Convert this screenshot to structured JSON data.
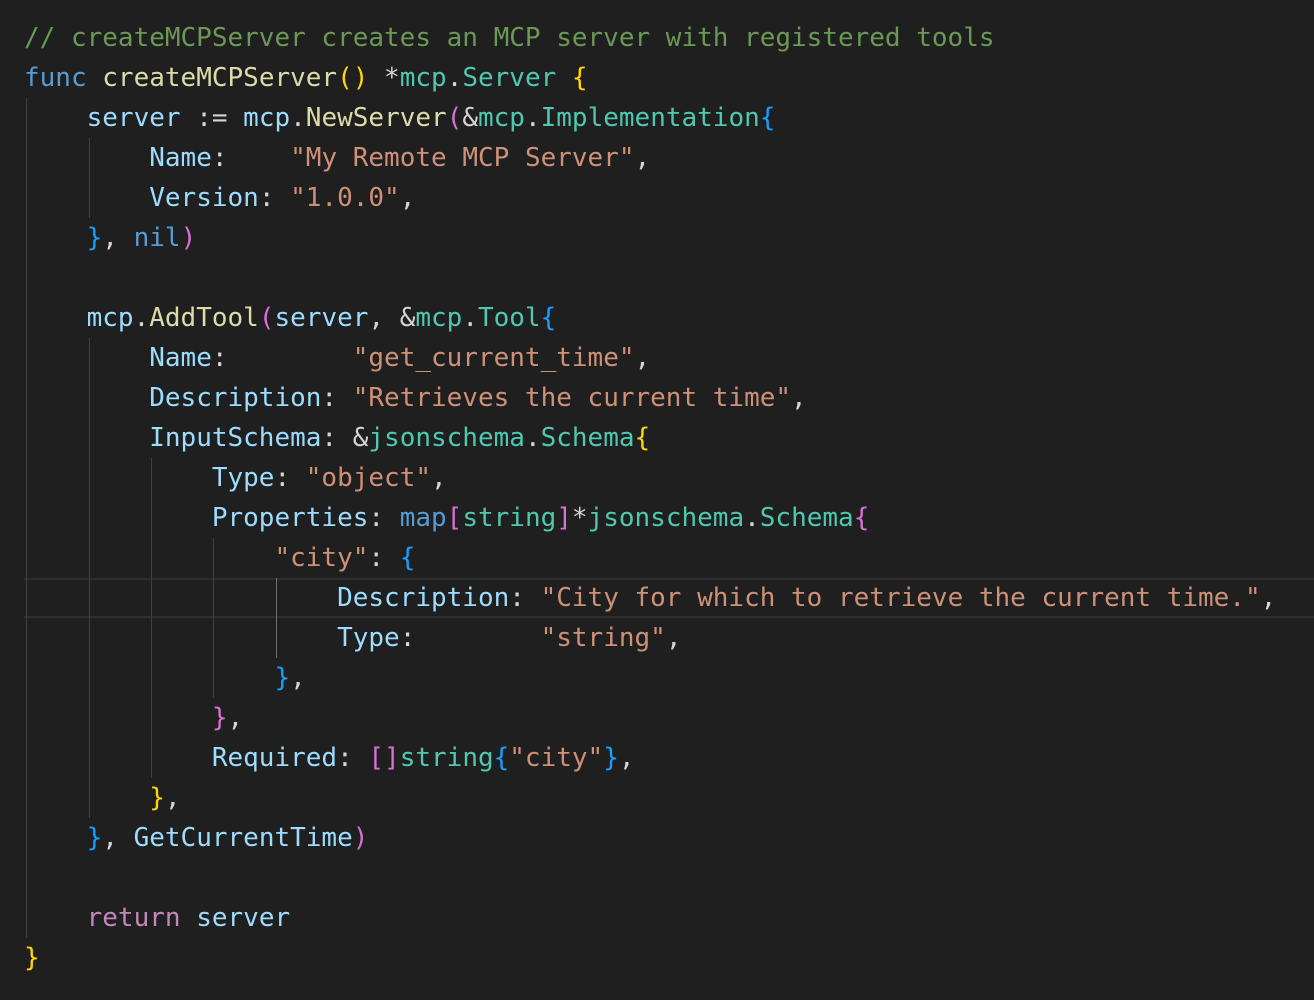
{
  "editor": {
    "current_line_index": 14,
    "lines": [
      [
        {
          "text": "// createMCPServer creates an MCP server with registered tools",
          "cls": "t-comment"
        }
      ],
      [
        {
          "text": "func",
          "cls": "t-keyword"
        },
        {
          "text": " ",
          "cls": "t-op"
        },
        {
          "text": "createMCPServer",
          "cls": "t-func"
        },
        {
          "text": "()",
          "cls": "t-b1"
        },
        {
          "text": " *",
          "cls": "t-op"
        },
        {
          "text": "mcp",
          "cls": "t-type"
        },
        {
          "text": ".",
          "cls": "t-op"
        },
        {
          "text": "Server",
          "cls": "t-type"
        },
        {
          "text": " ",
          "cls": "t-op"
        },
        {
          "text": "{",
          "cls": "t-b1"
        }
      ],
      [
        {
          "text": "    ",
          "cls": "t-op"
        },
        {
          "text": "server",
          "cls": "t-var"
        },
        {
          "text": " := ",
          "cls": "t-op"
        },
        {
          "text": "mcp",
          "cls": "t-var"
        },
        {
          "text": ".",
          "cls": "t-op"
        },
        {
          "text": "NewServer",
          "cls": "t-func"
        },
        {
          "text": "(",
          "cls": "t-b2"
        },
        {
          "text": "&",
          "cls": "t-op"
        },
        {
          "text": "mcp",
          "cls": "t-type"
        },
        {
          "text": ".",
          "cls": "t-op"
        },
        {
          "text": "Implementation",
          "cls": "t-type"
        },
        {
          "text": "{",
          "cls": "t-b3"
        }
      ],
      [
        {
          "text": "        ",
          "cls": "t-op"
        },
        {
          "text": "Name",
          "cls": "t-var"
        },
        {
          "text": ":    ",
          "cls": "t-op"
        },
        {
          "text": "\"My Remote MCP Server\"",
          "cls": "t-string"
        },
        {
          "text": ",",
          "cls": "t-op"
        }
      ],
      [
        {
          "text": "        ",
          "cls": "t-op"
        },
        {
          "text": "Version",
          "cls": "t-var"
        },
        {
          "text": ": ",
          "cls": "t-op"
        },
        {
          "text": "\"1.0.0\"",
          "cls": "t-string"
        },
        {
          "text": ",",
          "cls": "t-op"
        }
      ],
      [
        {
          "text": "    ",
          "cls": "t-op"
        },
        {
          "text": "}",
          "cls": "t-b3"
        },
        {
          "text": ", ",
          "cls": "t-op"
        },
        {
          "text": "nil",
          "cls": "t-keyword"
        },
        {
          "text": ")",
          "cls": "t-b2"
        }
      ],
      [
        {
          "text": "",
          "cls": "t-op"
        }
      ],
      [
        {
          "text": "    ",
          "cls": "t-op"
        },
        {
          "text": "mcp",
          "cls": "t-var"
        },
        {
          "text": ".",
          "cls": "t-op"
        },
        {
          "text": "AddTool",
          "cls": "t-func"
        },
        {
          "text": "(",
          "cls": "t-b2"
        },
        {
          "text": "server",
          "cls": "t-var"
        },
        {
          "text": ", &",
          "cls": "t-op"
        },
        {
          "text": "mcp",
          "cls": "t-type"
        },
        {
          "text": ".",
          "cls": "t-op"
        },
        {
          "text": "Tool",
          "cls": "t-type"
        },
        {
          "text": "{",
          "cls": "t-b3"
        }
      ],
      [
        {
          "text": "        ",
          "cls": "t-op"
        },
        {
          "text": "Name",
          "cls": "t-var"
        },
        {
          "text": ":        ",
          "cls": "t-op"
        },
        {
          "text": "\"get_current_time\"",
          "cls": "t-string"
        },
        {
          "text": ",",
          "cls": "t-op"
        }
      ],
      [
        {
          "text": "        ",
          "cls": "t-op"
        },
        {
          "text": "Description",
          "cls": "t-var"
        },
        {
          "text": ": ",
          "cls": "t-op"
        },
        {
          "text": "\"Retrieves the current time\"",
          "cls": "t-string"
        },
        {
          "text": ",",
          "cls": "t-op"
        }
      ],
      [
        {
          "text": "        ",
          "cls": "t-op"
        },
        {
          "text": "InputSchema",
          "cls": "t-var"
        },
        {
          "text": ": &",
          "cls": "t-op"
        },
        {
          "text": "jsonschema",
          "cls": "t-type"
        },
        {
          "text": ".",
          "cls": "t-op"
        },
        {
          "text": "Schema",
          "cls": "t-type"
        },
        {
          "text": "{",
          "cls": "t-b1"
        }
      ],
      [
        {
          "text": "            ",
          "cls": "t-op"
        },
        {
          "text": "Type",
          "cls": "t-var"
        },
        {
          "text": ": ",
          "cls": "t-op"
        },
        {
          "text": "\"object\"",
          "cls": "t-string"
        },
        {
          "text": ",",
          "cls": "t-op"
        }
      ],
      [
        {
          "text": "            ",
          "cls": "t-op"
        },
        {
          "text": "Properties",
          "cls": "t-var"
        },
        {
          "text": ": ",
          "cls": "t-op"
        },
        {
          "text": "map",
          "cls": "t-keyword"
        },
        {
          "text": "[",
          "cls": "t-b2"
        },
        {
          "text": "string",
          "cls": "t-type"
        },
        {
          "text": "]",
          "cls": "t-b2"
        },
        {
          "text": "*",
          "cls": "t-op"
        },
        {
          "text": "jsonschema",
          "cls": "t-type"
        },
        {
          "text": ".",
          "cls": "t-op"
        },
        {
          "text": "Schema",
          "cls": "t-type"
        },
        {
          "text": "{",
          "cls": "t-b2"
        }
      ],
      [
        {
          "text": "                ",
          "cls": "t-op"
        },
        {
          "text": "\"city\"",
          "cls": "t-string"
        },
        {
          "text": ": ",
          "cls": "t-op"
        },
        {
          "text": "{",
          "cls": "t-b3"
        }
      ],
      [
        {
          "text": "                    ",
          "cls": "t-op"
        },
        {
          "text": "Description",
          "cls": "t-var"
        },
        {
          "text": ": ",
          "cls": "t-op"
        },
        {
          "text": "\"City for which to retrieve the current time.\"",
          "cls": "t-string"
        },
        {
          "text": ",",
          "cls": "t-op"
        }
      ],
      [
        {
          "text": "                    ",
          "cls": "t-op"
        },
        {
          "text": "Type",
          "cls": "t-var"
        },
        {
          "text": ":        ",
          "cls": "t-op"
        },
        {
          "text": "\"string\"",
          "cls": "t-string"
        },
        {
          "text": ",",
          "cls": "t-op"
        }
      ],
      [
        {
          "text": "                ",
          "cls": "t-op"
        },
        {
          "text": "}",
          "cls": "t-b3"
        },
        {
          "text": ",",
          "cls": "t-op"
        }
      ],
      [
        {
          "text": "            ",
          "cls": "t-op"
        },
        {
          "text": "}",
          "cls": "t-b2"
        },
        {
          "text": ",",
          "cls": "t-op"
        }
      ],
      [
        {
          "text": "            ",
          "cls": "t-op"
        },
        {
          "text": "Required",
          "cls": "t-var"
        },
        {
          "text": ": ",
          "cls": "t-op"
        },
        {
          "text": "[]",
          "cls": "t-b2"
        },
        {
          "text": "string",
          "cls": "t-type"
        },
        {
          "text": "{",
          "cls": "t-b3"
        },
        {
          "text": "\"city\"",
          "cls": "t-string"
        },
        {
          "text": "}",
          "cls": "t-b3"
        },
        {
          "text": ",",
          "cls": "t-op"
        }
      ],
      [
        {
          "text": "        ",
          "cls": "t-op"
        },
        {
          "text": "}",
          "cls": "t-b1"
        },
        {
          "text": ",",
          "cls": "t-op"
        }
      ],
      [
        {
          "text": "    ",
          "cls": "t-op"
        },
        {
          "text": "}",
          "cls": "t-b3"
        },
        {
          "text": ", ",
          "cls": "t-op"
        },
        {
          "text": "GetCurrentTime",
          "cls": "t-var"
        },
        {
          "text": ")",
          "cls": "t-b2"
        }
      ],
      [
        {
          "text": "",
          "cls": "t-op"
        }
      ],
      [
        {
          "text": "    ",
          "cls": "t-op"
        },
        {
          "text": "return",
          "cls": "t-control"
        },
        {
          "text": " ",
          "cls": "t-op"
        },
        {
          "text": "server",
          "cls": "t-var"
        }
      ],
      [
        {
          "text": "}",
          "cls": "t-b1"
        }
      ]
    ]
  },
  "colors": {
    "background": "#1f1f1f",
    "comment": "#6a9955",
    "keyword": "#569cd6",
    "control_keyword": "#c586c0",
    "function": "#dcdcaa",
    "type": "#4ec9b0",
    "variable": "#9cdcfe",
    "string": "#ce9178",
    "bracket_level_1": "#ffd700",
    "bracket_level_2": "#da70d6",
    "bracket_level_3": "#179fff"
  }
}
